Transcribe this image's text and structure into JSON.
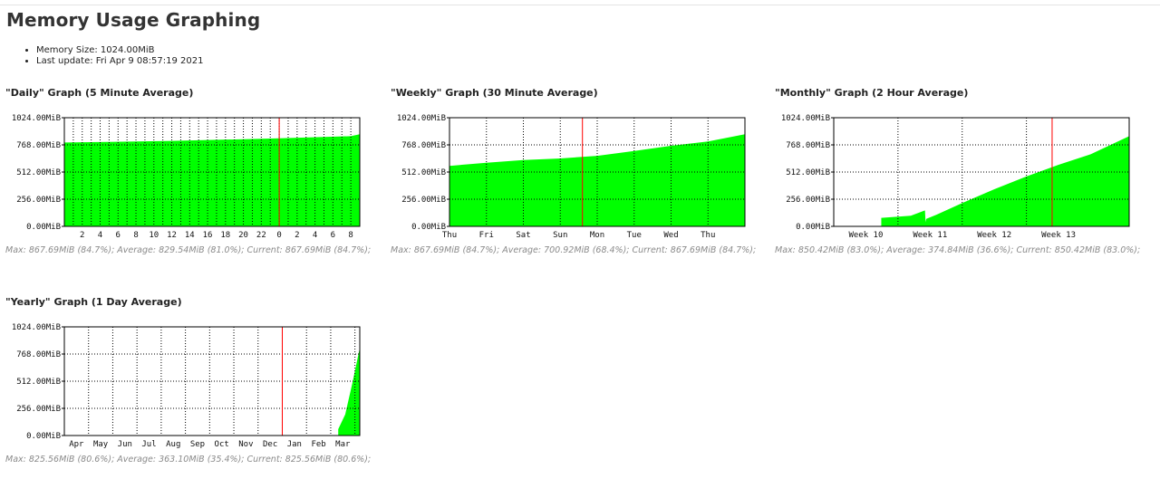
{
  "page": {
    "title": "Memory Usage Graphing",
    "info": [
      "Memory Size: 1024.00MiB",
      "Last update: Fri Apr 9 08:57:19 2021"
    ]
  },
  "colors": {
    "fill": "#00ff00",
    "now_line": "#ff0000",
    "grid": "#000000",
    "axis": "#000000"
  },
  "graphs": [
    {
      "title": "\"Daily\" Graph (5 Minute Average)",
      "stats": "Max: 867.69MiB (84.7%); Average: 829.54MiB (81.0%); Current: 867.69MiB (84.7%);"
    },
    {
      "title": "\"Weekly\" Graph (30 Minute Average)",
      "stats": "Max: 867.69MiB (84.7%); Average: 700.92MiB (68.4%); Current: 867.69MiB (84.7%);"
    },
    {
      "title": "\"Monthly\" Graph (2 Hour Average)",
      "stats": "Max: 850.42MiB (83.0%); Average: 374.84MiB (36.6%); Current: 850.42MiB (83.0%);"
    },
    {
      "title": "\"Yearly\" Graph (1 Day Average)",
      "stats": "Max: 825.56MiB (80.6%); Average: 363.10MiB (35.4%); Current: 825.56MiB (80.6%);"
    }
  ],
  "chart_data": [
    {
      "type": "area",
      "title": "\"Daily\" Graph (5 Minute Average)",
      "ylim": [
        0,
        1024
      ],
      "yticks": [
        "0.00MiB",
        "256.00MiB",
        "512.00MiB",
        "768.00MiB",
        "1024.00MiB"
      ],
      "ytick_values": [
        0,
        256,
        512,
        768,
        1024
      ],
      "grid": true,
      "xlim": [
        0,
        33
      ],
      "xticks": [
        "2",
        "4",
        "6",
        "8",
        "10",
        "12",
        "14",
        "16",
        "18",
        "20",
        "22",
        "0",
        "2",
        "4",
        "6",
        "8"
      ],
      "xtick_values": [
        2,
        4,
        6,
        8,
        10,
        12,
        14,
        16,
        18,
        20,
        22,
        24,
        26,
        28,
        30,
        32
      ],
      "minor_grid_step": 1,
      "now_marker": 24,
      "series": [
        {
          "x": [
            0,
            12,
            24,
            32,
            33
          ],
          "y": [
            790,
            805,
            830,
            850,
            868
          ]
        }
      ]
    },
    {
      "type": "area",
      "title": "\"Weekly\" Graph (30 Minute Average)",
      "ylim": [
        0,
        1024
      ],
      "yticks": [
        "0.00MiB",
        "256.00MiB",
        "512.00MiB",
        "768.00MiB",
        "1024.00MiB"
      ],
      "ytick_values": [
        0,
        256,
        512,
        768,
        1024
      ],
      "grid": true,
      "xlim": [
        0,
        8
      ],
      "xticks": [
        "Thu",
        "Fri",
        "Sat",
        "Sun",
        "Mon",
        "Tue",
        "Wed",
        "Thu"
      ],
      "xtick_values": [
        0,
        1,
        2,
        3,
        4,
        5,
        6,
        7
      ],
      "now_marker": 3.6,
      "series": [
        {
          "x": [
            0,
            1,
            2,
            3,
            4,
            5,
            6,
            7,
            8
          ],
          "y": [
            570,
            600,
            625,
            640,
            665,
            710,
            760,
            800,
            868
          ]
        }
      ]
    },
    {
      "type": "area",
      "title": "\"Monthly\" Graph (2 Hour Average)",
      "ylim": [
        0,
        1024
      ],
      "yticks": [
        "0.00MiB",
        "256.00MiB",
        "512.00MiB",
        "768.00MiB",
        "1024.00MiB"
      ],
      "ytick_values": [
        0,
        256,
        512,
        768,
        1024
      ],
      "grid": true,
      "xlim": [
        0,
        4.6
      ],
      "xticks": [
        "Week 10",
        "Week 11",
        "Week 12",
        "Week 13"
      ],
      "xtick_values": [
        0.5,
        1.5,
        2.5,
        3.5
      ],
      "vgrid_values": [
        1,
        2,
        3
      ],
      "now_marker": 3.4,
      "series": [
        {
          "x": [
            0,
            0.73,
            0.74,
            1.2,
            1.42,
            1.43,
            1.44,
            1.6,
            2.0,
            2.5,
            3.0,
            3.5,
            4.0,
            4.6
          ],
          "y": [
            null,
            null,
            80,
            100,
            150,
            40,
            70,
            110,
            220,
            350,
            470,
            580,
            680,
            850
          ]
        }
      ]
    },
    {
      "type": "area",
      "title": "\"Yearly\" Graph (1 Day Average)",
      "ylim": [
        0,
        1024
      ],
      "yticks": [
        "0.00MiB",
        "256.00MiB",
        "512.00MiB",
        "768.00MiB",
        "1024.00MiB"
      ],
      "ytick_values": [
        0,
        256,
        512,
        768,
        1024
      ],
      "grid": true,
      "xlim": [
        0,
        12.2
      ],
      "xticks": [
        "Apr",
        "May",
        "Jun",
        "Jul",
        "Aug",
        "Sep",
        "Oct",
        "Nov",
        "Dec",
        "Jan",
        "Feb",
        "Mar"
      ],
      "xtick_values": [
        0.5,
        1.5,
        2.5,
        3.5,
        4.5,
        5.5,
        6.5,
        7.5,
        8.5,
        9.5,
        10.5,
        11.5
      ],
      "vgrid_values": [
        1,
        2,
        3,
        4,
        5,
        6,
        7,
        8,
        9,
        10,
        11,
        12
      ],
      "now_marker": 9,
      "series": [
        {
          "x": [
            0,
            11.3,
            11.31,
            11.6,
            11.9,
            12.2
          ],
          "y": [
            null,
            null,
            60,
            200,
            500,
            826
          ]
        }
      ]
    }
  ]
}
